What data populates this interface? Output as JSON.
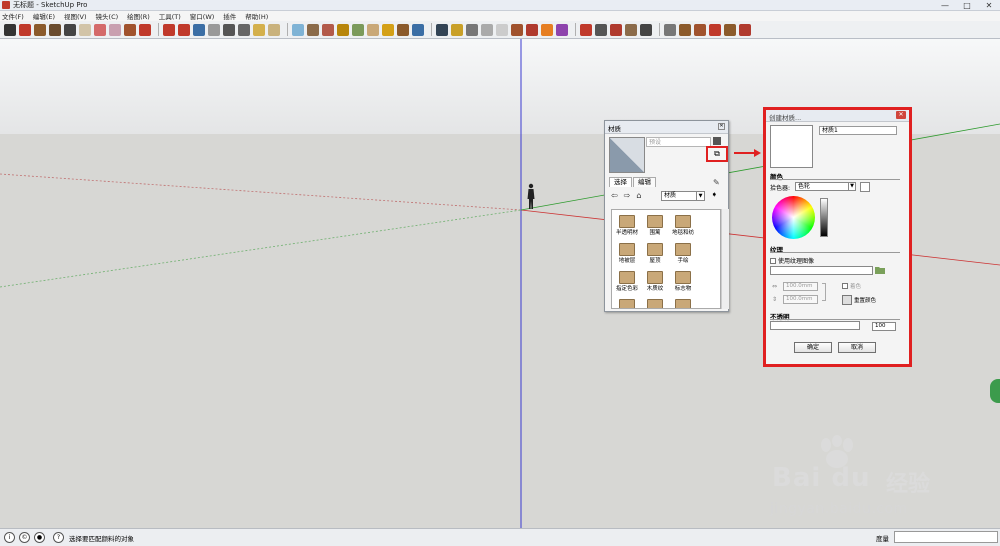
{
  "window": {
    "title": "无标题 - SketchUp Pro",
    "controls": [
      "—",
      "□",
      "✕"
    ]
  },
  "menu": [
    "文件(F)",
    "编辑(E)",
    "视图(V)",
    "镜头(C)",
    "绘图(R)",
    "工具(T)",
    "窗口(W)",
    "插件",
    "帮助(H)"
  ],
  "toolbar_colors": [
    "#333333",
    "#c0392b",
    "#8b5a2b",
    "#6b4c2e",
    "#444444",
    "#d2c4a8",
    "#d46a6a",
    "#c9a0b0",
    "#a0522d",
    "#c0392b",
    "#c0392b",
    "#c0392b",
    "#3b6ea5",
    "#999999",
    "#555555",
    "#666666",
    "#d4b04c",
    "#c9b27d",
    "#7fb3d5",
    "#8b6b4a",
    "#b35a4a",
    "#b8860b",
    "#7b9a5b",
    "#c9a878",
    "#d4a017",
    "#8b5a2b",
    "#3b6ea5",
    "#334455",
    "#c9a028",
    "#777777",
    "#aaaaaa",
    "#cccccc",
    "#a0522d",
    "#b03a2e",
    "#e67e22",
    "#8e44ad",
    "#c0392b",
    "#555555",
    "#b03a2e",
    "#8b6b4a",
    "#444444",
    "#777777",
    "#8b5a2b",
    "#a0522d",
    "#c0392b",
    "#8b5a2b",
    "#b03a2e"
  ],
  "materials_panel": {
    "title": "材质",
    "name_placeholder": "预设",
    "tabs": [
      "选择",
      "编辑"
    ],
    "collection": "材质",
    "items": [
      "半透明材",
      "围篱",
      "地毯和纺",
      "地被层",
      "屋顶",
      "手绘",
      "指定色彩",
      "木质纹",
      "标志物",
      "",
      "",
      ""
    ],
    "create_icon": "create-material-icon"
  },
  "create_material_dialog": {
    "title": "创建材质...",
    "name": "材质1",
    "color_section": "颜色",
    "picker_label": "拾色器:",
    "picker_value": "色轮",
    "texture_section": "纹理",
    "use_texture_label": "使用纹理图像",
    "width_value": "100.0mm",
    "height_value": "100.0mm",
    "colorize_label": "着色",
    "reset_color_label": "重置颜色",
    "opacity_section": "不透明",
    "opacity_value": "100",
    "ok_label": "确定",
    "cancel_label": "取消"
  },
  "statusbar": {
    "hint": "选择要匹配颜料的对象",
    "measure_label": "度量",
    "measure_value": ""
  },
  "watermark": {
    "brand": "Bai du",
    "brand_cn": "经验",
    "url": "jingyan.baidu.com"
  }
}
